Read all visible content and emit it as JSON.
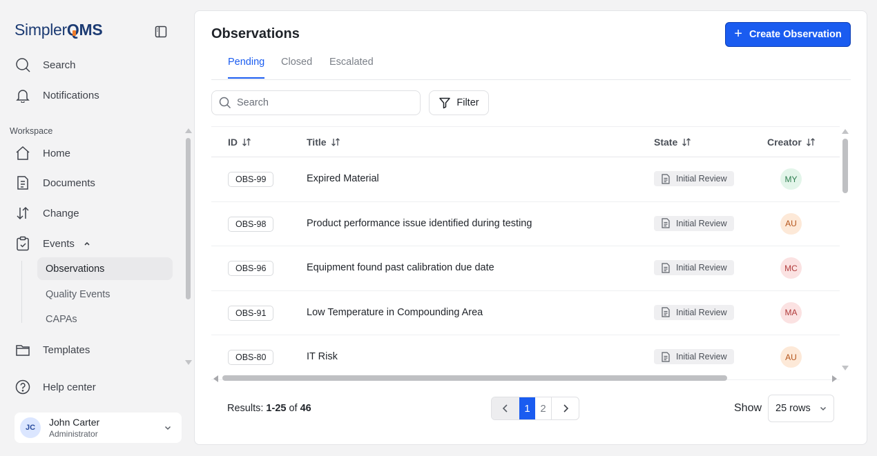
{
  "app": {
    "logo_left": "Simpler",
    "logo_right": "MS",
    "logo_o": "Q"
  },
  "sidebar": {
    "search_label": "Search",
    "notifications_label": "Notifications",
    "section_label": "Workspace",
    "items": [
      {
        "label": "Home",
        "icon": "home-icon"
      },
      {
        "label": "Documents",
        "icon": "document-icon"
      },
      {
        "label": "Change",
        "icon": "sort-arrows-icon"
      },
      {
        "label": "Events",
        "icon": "clipboard-check-icon"
      }
    ],
    "sub_items": [
      {
        "label": "Observations",
        "active": true
      },
      {
        "label": "Quality Events",
        "active": false
      },
      {
        "label": "CAPAs",
        "active": false
      }
    ],
    "templates_label": "Templates",
    "help_label": "Help center",
    "user": {
      "initials": "JC",
      "name": "John Carter",
      "role": "Administrator"
    }
  },
  "main": {
    "title": "Observations",
    "create_label": "Create Observation",
    "tabs": [
      "Pending",
      "Closed",
      "Escalated"
    ],
    "active_tab": "Pending",
    "search": {
      "placeholder": "Search"
    },
    "filter_label": "Filter",
    "columns": [
      "ID",
      "Title",
      "State",
      "Creator"
    ],
    "rows": [
      {
        "id": "OBS-99",
        "title": "Expired Material",
        "state": "Initial Review",
        "creator": "MY",
        "creator_bg": "#e3f5ea",
        "creator_fg": "#2e7d4f"
      },
      {
        "id": "OBS-98",
        "title": "Product performance issue identified during testing",
        "state": "Initial Review",
        "creator": "AU",
        "creator_bg": "#fde9d8",
        "creator_fg": "#b4541a"
      },
      {
        "id": "OBS-96",
        "title": "Equipment found past calibration due date",
        "state": "Initial Review",
        "creator": "MC",
        "creator_bg": "#fbe2e2",
        "creator_fg": "#b03a3a"
      },
      {
        "id": "OBS-91",
        "title": "Low Temperature in Compounding Area",
        "state": "Initial Review",
        "creator": "MA",
        "creator_bg": "#fbe2e2",
        "creator_fg": "#b03a3a"
      },
      {
        "id": "OBS-80",
        "title": "IT Risk",
        "state": "Initial Review",
        "creator": "AU",
        "creator_bg": "#fde9d8",
        "creator_fg": "#b4541a"
      }
    ],
    "results": {
      "prefix": "Results: ",
      "range": "1-25",
      "of": " of ",
      "total": "46"
    },
    "pagination": {
      "pages": [
        "1",
        "2"
      ],
      "current": "1"
    },
    "show_label": "Show",
    "rows_per_page": "25 rows"
  },
  "colors": {
    "accent": "#1a5cf0",
    "logo": "#1c3b73",
    "logo_mark": "#ef7d2c"
  }
}
